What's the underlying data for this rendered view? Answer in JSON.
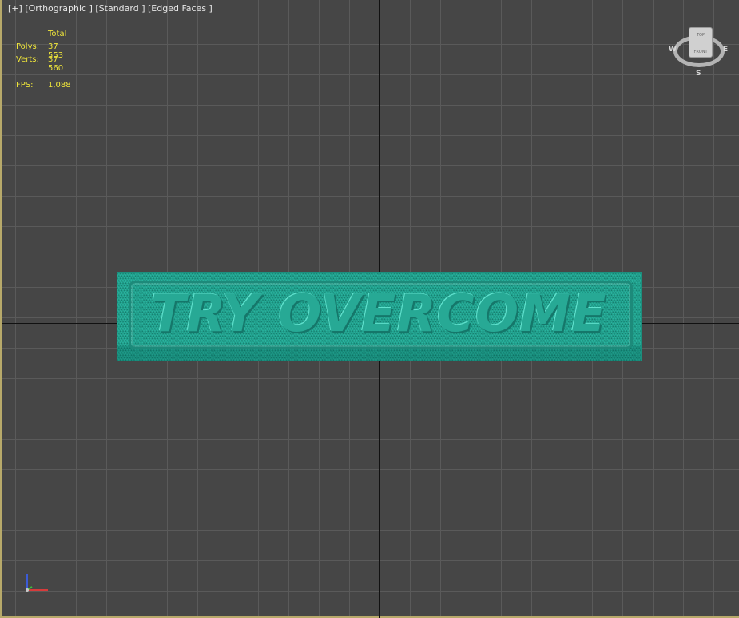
{
  "viewport": {
    "label": "[+] [Orthographic ] [Standard ] [Edged Faces ]"
  },
  "stats": {
    "header": "Total",
    "polys_label": "Polys:",
    "polys_value": "37 553",
    "verts_label": "Verts:",
    "verts_value": "37 560",
    "fps_label": "FPS:",
    "fps_value": "1,088"
  },
  "model": {
    "text": "TRY OVERCOME",
    "color": "#29b39e"
  },
  "viewcube": {
    "top_label": "TOP",
    "front_label": "FRONT",
    "west": "W",
    "east": "E",
    "south": "S"
  },
  "gizmo": {
    "icon": "axis-tripod-icon"
  },
  "colors": {
    "background": "#464646",
    "grid": "#5a5a5a",
    "stats_text": "#f0e63a",
    "viewport_border": "#b7a96a"
  }
}
